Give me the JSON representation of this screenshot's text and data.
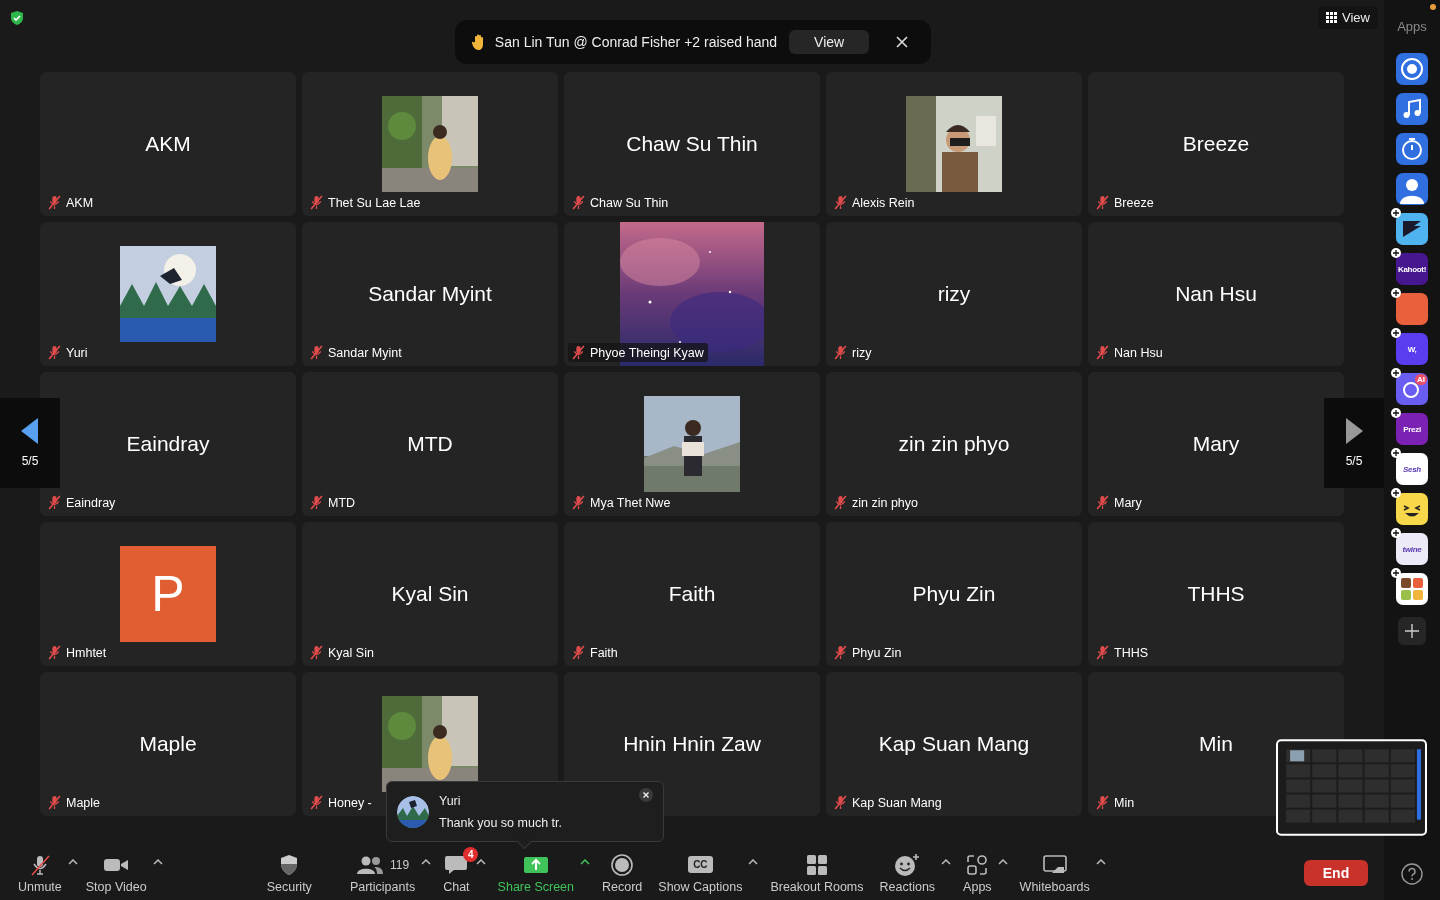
{
  "banner": {
    "text": "San Lin Tun @ Conrad Fisher +2 raised hand",
    "view_button": "View"
  },
  "view_button": "View",
  "apps_label": "Apps",
  "apps_notification": true,
  "pager_left": {
    "page": "5/5"
  },
  "pager_right": {
    "page": "5/5"
  },
  "tiles": [
    {
      "kind": "name",
      "display_name": "AKM",
      "label": "AKM",
      "muted": true
    },
    {
      "kind": "picture",
      "label": "Thet Su Lae Lae",
      "muted": true
    },
    {
      "kind": "name",
      "display_name": "Chaw Su Thin",
      "label": "Chaw Su Thin",
      "muted": true
    },
    {
      "kind": "picture",
      "label": "Alexis Rein",
      "muted": true
    },
    {
      "kind": "name",
      "display_name": "Breeze",
      "label": "Breeze",
      "muted": true
    },
    {
      "kind": "picture",
      "label": "Yuri",
      "muted": true
    },
    {
      "kind": "name",
      "display_name": "Sandar Myint",
      "label": "Sandar Myint",
      "muted": true
    },
    {
      "kind": "tall-picture",
      "label": "Phyoe Theingi Kyaw",
      "muted": true
    },
    {
      "kind": "name",
      "display_name": "rizy",
      "label": "rizy",
      "muted": true
    },
    {
      "kind": "name",
      "display_name": "Nan Hsu",
      "label": "Nan Hsu",
      "muted": true
    },
    {
      "kind": "name",
      "display_name": "Eaindray",
      "label": "Eaindray",
      "muted": true
    },
    {
      "kind": "name",
      "display_name": "MTD",
      "label": "MTD",
      "muted": true
    },
    {
      "kind": "picture",
      "label": "Mya Thet Nwe",
      "muted": true
    },
    {
      "kind": "name",
      "display_name": "zin zin phyo",
      "label": "zin zin phyo",
      "muted": true
    },
    {
      "kind": "name",
      "display_name": "Mary",
      "label": "Mary",
      "muted": true
    },
    {
      "kind": "letter",
      "letter": "P",
      "label": "Hmhtet",
      "muted": true
    },
    {
      "kind": "name",
      "display_name": "Kyal Sin",
      "label": "Kyal Sin",
      "muted": true
    },
    {
      "kind": "name",
      "display_name": "Faith",
      "label": "Faith",
      "muted": true
    },
    {
      "kind": "name",
      "display_name": "Phyu Zin",
      "label": "Phyu Zin",
      "muted": true
    },
    {
      "kind": "name",
      "display_name": "THHS",
      "label": "THHS",
      "muted": true
    },
    {
      "kind": "name",
      "display_name": "Maple",
      "label": "Maple",
      "muted": true
    },
    {
      "kind": "picture",
      "label": "Honey -",
      "muted": true
    },
    {
      "kind": "name",
      "display_name": "Hnin Hnin Zaw"
    },
    {
      "kind": "name",
      "display_name": "Kap Suan Mang",
      "label": "Kap Suan Mang",
      "muted": true
    },
    {
      "kind": "name",
      "display_name": "Min",
      "label": "Min",
      "muted": true
    }
  ],
  "apps": [
    {
      "kind": "camera",
      "color": "#2f6fe0",
      "plus": false
    },
    {
      "kind": "music",
      "color": "#2f6fe0",
      "plus": false
    },
    {
      "kind": "timer",
      "color": "#2f6fe0",
      "plus": false
    },
    {
      "kind": "contact",
      "color": "#2f6fe0",
      "plus": false
    },
    {
      "kind": "arrow",
      "color": "#4fb3f0",
      "plus": true
    },
    {
      "kind": "text",
      "label": "Kahoot!",
      "color": "#46178f",
      "plus": true
    },
    {
      "kind": "block",
      "color": "#e8613c",
      "plus": true
    },
    {
      "kind": "text",
      "label": "W,",
      "color": "#5b3df0",
      "plus": true
    },
    {
      "kind": "ai",
      "label": "AI",
      "color": "#6a5df2",
      "plus": true
    },
    {
      "kind": "text",
      "label": "Prezi",
      "color": "#7b22b5",
      "plus": true
    },
    {
      "kind": "text",
      "label": "Sesh",
      "color": "#ffffff",
      "plus": true
    },
    {
      "kind": "smile",
      "color": "#f7d84a",
      "plus": true
    },
    {
      "kind": "text",
      "label": "twine",
      "color": "#eceaf6",
      "plus": true
    },
    {
      "kind": "tiles",
      "color": "#ffffff",
      "plus": true
    }
  ],
  "toolbar": [
    {
      "kind": "mic-off",
      "label": "Unmute",
      "caret": true
    },
    {
      "kind": "video",
      "label": "Stop Video",
      "caret": true
    },
    {
      "kind": "shield",
      "label": "Security",
      "caret": false
    },
    {
      "kind": "people",
      "label": "Participants",
      "count": "119",
      "caret": true
    },
    {
      "kind": "chat",
      "label": "Chat",
      "badge": "4",
      "caret": true
    },
    {
      "kind": "share",
      "label": "Share Screen",
      "caret": true,
      "highlight": true
    },
    {
      "kind": "record",
      "label": "Record",
      "caret": false
    },
    {
      "kind": "cc",
      "icon_text": "CC",
      "label": "Show Captions",
      "caret": true
    },
    {
      "kind": "grid",
      "label": "Breakout Rooms",
      "caret": false
    },
    {
      "kind": "smile",
      "label": "Reactions",
      "caret": true
    },
    {
      "kind": "apps",
      "label": "Apps",
      "caret": true
    },
    {
      "kind": "whiteboard",
      "label": "Whiteboards",
      "caret": true
    }
  ],
  "end_button": "End",
  "chat_popup": {
    "sender": "Yuri",
    "message": "Thank you so much tr."
  }
}
